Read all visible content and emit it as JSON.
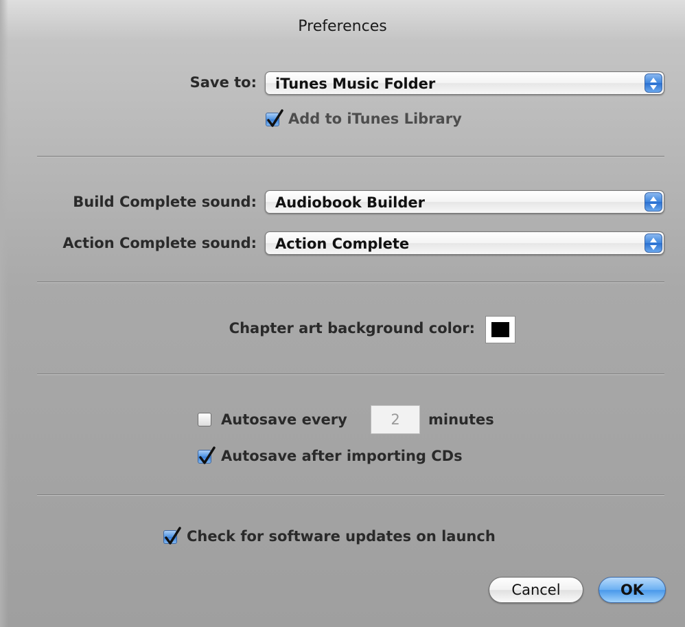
{
  "window": {
    "title": "Preferences"
  },
  "save": {
    "label": "Save to:",
    "value": "iTunes Music Folder",
    "add_library_label": "Add to iTunes Library",
    "add_library_checked": true
  },
  "sounds": {
    "build_label": "Build Complete sound:",
    "build_value": "Audiobook Builder",
    "action_label": "Action Complete sound:",
    "action_value": "Action Complete"
  },
  "chapter_art": {
    "label": "Chapter art background color:",
    "color": "#000000"
  },
  "autosave": {
    "every_label": "Autosave every",
    "every_checked": false,
    "minutes_value": "2",
    "minutes_label": "minutes",
    "after_import_label": "Autosave after importing CDs",
    "after_import_checked": true
  },
  "updates": {
    "label": "Check for software updates on launch",
    "checked": true
  },
  "buttons": {
    "cancel": "Cancel",
    "ok": "OK"
  },
  "icons": {
    "popup_arrows": "up-down-arrows-icon",
    "checkmark": "checkmark-icon"
  },
  "colors": {
    "accent": "#3f86de",
    "window_background": "#a9a9a9"
  }
}
